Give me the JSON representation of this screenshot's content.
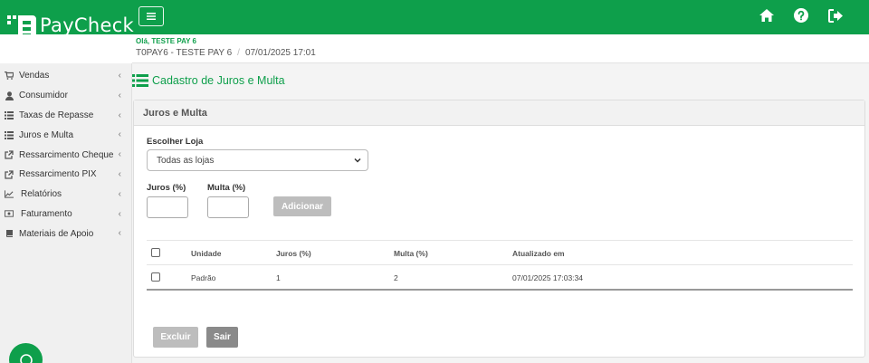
{
  "app": {
    "name": "PayCheck"
  },
  "colors": {
    "brand": "#0e9f4b",
    "disabled_button": "#bdbdbd",
    "dark_button": "#8a8a8a"
  },
  "header": {
    "menu_icon": "hamburger-icon",
    "icons": [
      "home-icon",
      "help-icon",
      "logout-icon"
    ]
  },
  "subheader": {
    "greeting": "Olá, TESTE PAY 6",
    "store": "T0PAY6 - TESTE PAY 6",
    "separator": "/",
    "datetime": "07/01/2025 17:01"
  },
  "sidebar": {
    "items": [
      {
        "label": "Vendas",
        "icon": "cart-icon"
      },
      {
        "label": "Consumidor",
        "icon": "user-icon"
      },
      {
        "label": "Taxas de Repasse",
        "icon": "list-icon"
      },
      {
        "label": "Juros e Multa",
        "icon": "list-icon"
      },
      {
        "label": "Ressarcimento Cheque",
        "icon": "external-link-icon"
      },
      {
        "label": "Ressarcimento PIX",
        "icon": "external-link-icon"
      },
      {
        "label": "Relatórios",
        "icon": "line-chart-icon"
      },
      {
        "label": "Faturamento",
        "icon": "money-icon"
      },
      {
        "label": "Materiais de Apoio",
        "icon": "book-icon"
      }
    ],
    "chevron": "‹"
  },
  "page": {
    "title": "Cadastro de Juros e Multa",
    "panel_title": "Juros e Multa",
    "store_label": "Escolher Loja",
    "store_select": "Todas as lojas",
    "juros_label": "Juros (%)",
    "multa_label": "Multa (%)",
    "juros_value": "",
    "multa_value": "",
    "add_button": "Adicionar",
    "delete_button": "Excluir",
    "exit_button": "Sair"
  },
  "table": {
    "columns": [
      "Unidade",
      "Juros (%)",
      "Multa (%)",
      "Atualizado em"
    ],
    "rows": [
      {
        "unidade": "Padrão",
        "juros": "1",
        "multa": "2",
        "atualizado": "07/01/2025 17:03:34"
      }
    ]
  }
}
